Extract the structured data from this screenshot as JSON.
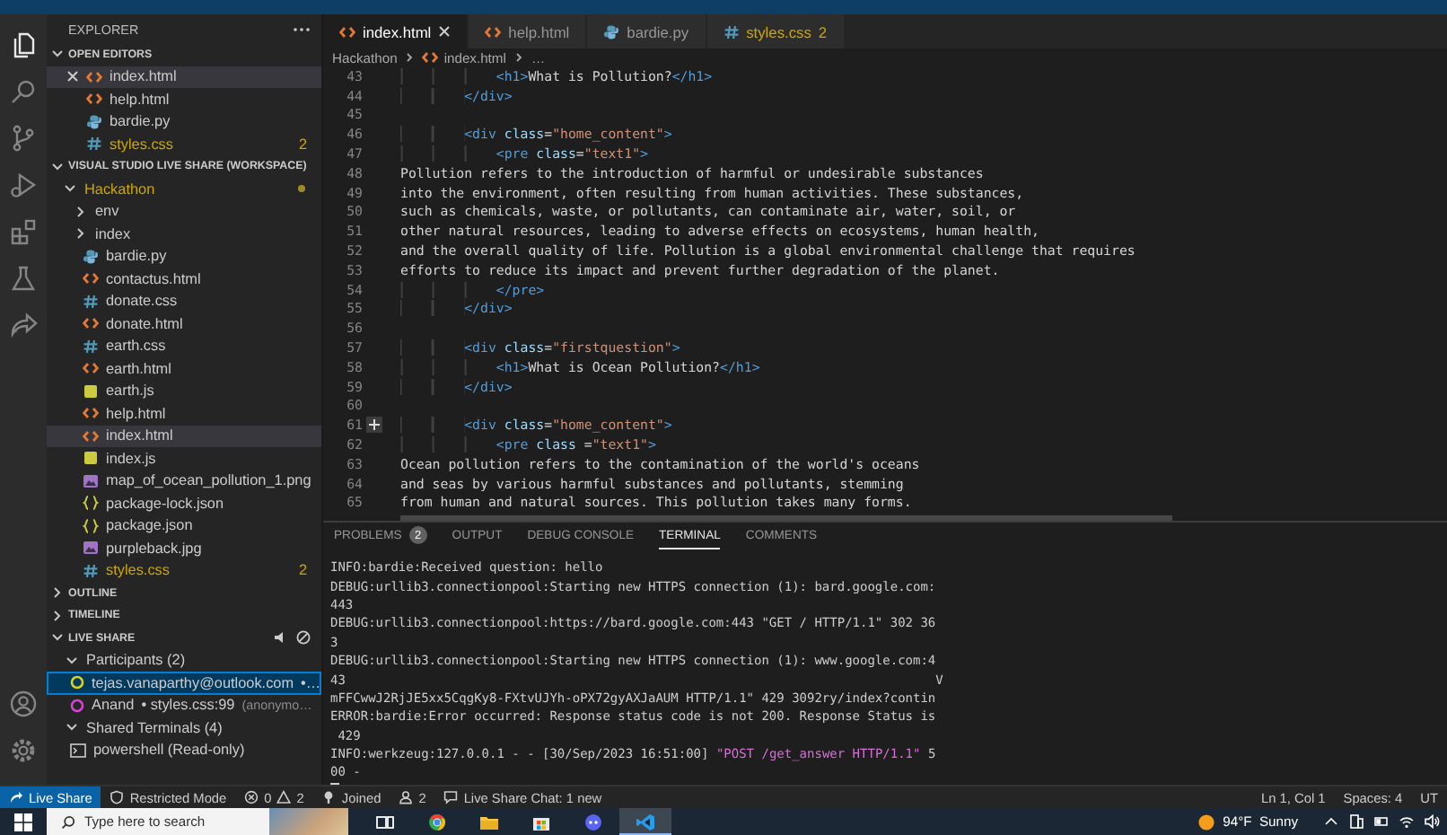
{
  "sidebar": {
    "title": "EXPLORER",
    "open_editors": {
      "heading": "OPEN EDITORS",
      "expanded": true,
      "items": [
        {
          "name": "index.html",
          "kind": "html",
          "selected": true
        },
        {
          "name": "help.html",
          "kind": "html",
          "selected": false
        },
        {
          "name": "bardie.py",
          "kind": "python",
          "selected": false
        },
        {
          "name": "styles.css",
          "kind": "css",
          "selected": false,
          "badge": "2"
        }
      ]
    },
    "workspace": {
      "heading": "VISUAL STUDIO LIVE SHARE (WORKSPACE)",
      "expanded": true,
      "tree": [
        {
          "name": "Hackathon",
          "kind": "folder",
          "expanded": true,
          "modified": true,
          "selected": false,
          "children": [
            {
              "name": "env",
              "kind": "folder",
              "expanded": false,
              "modified": false,
              "selected": false
            },
            {
              "name": "index",
              "kind": "folder",
              "expanded": false,
              "modified": false,
              "selected": false
            },
            {
              "name": "bardie.py",
              "kind": "python",
              "selected": false
            },
            {
              "name": "contactus.html",
              "kind": "html",
              "selected": false
            },
            {
              "name": "donate.css",
              "kind": "css",
              "selected": false
            },
            {
              "name": "donate.html",
              "kind": "html",
              "selected": false
            },
            {
              "name": "earth.css",
              "kind": "css",
              "selected": false
            },
            {
              "name": "earth.html",
              "kind": "html",
              "selected": false
            },
            {
              "name": "earth.js",
              "kind": "js",
              "selected": false
            },
            {
              "name": "help.html",
              "kind": "html",
              "selected": false
            },
            {
              "name": "index.html",
              "kind": "html",
              "selected": true
            },
            {
              "name": "index.js",
              "kind": "js",
              "selected": false
            },
            {
              "name": "map_of_ocean_pollution_1.png",
              "kind": "image",
              "selected": false
            },
            {
              "name": "package-lock.json",
              "kind": "json",
              "selected": false
            },
            {
              "name": "package.json",
              "kind": "json",
              "selected": false
            },
            {
              "name": "purpleback.jpg",
              "kind": "image",
              "selected": false
            },
            {
              "name": "styles.css",
              "kind": "css",
              "selected": false,
              "badge": "2"
            }
          ]
        }
      ]
    },
    "outline": {
      "heading": "OUTLINE",
      "expanded": false
    },
    "timeline": {
      "heading": "TIMELINE",
      "expanded": false
    },
    "live_share": {
      "heading": "LIVE SHARE",
      "expanded": true,
      "groups": [
        {
          "label": "Participants (2)",
          "kind": "participants",
          "expanded": true,
          "children": [
            {
              "name": "tejas.vanaparthy@outlook.com",
              "detail": "•…",
              "selected": true,
              "color": "#d4d41e"
            },
            {
              "name": "Anand",
              "detail": "• styles.css:99",
              "note": "(anonymo…",
              "selected": false,
              "color": "#d643d6"
            }
          ]
        },
        {
          "label": "Shared Terminals (4)",
          "kind": "terminals",
          "expanded": true,
          "children": [
            {
              "name": "powershell (Read-only)",
              "selected": false
            }
          ]
        }
      ]
    }
  },
  "editor": {
    "tabs": [
      {
        "label": "index.html",
        "kind": "html",
        "selected": true
      },
      {
        "label": "help.html",
        "kind": "html",
        "selected": false
      },
      {
        "label": "bardie.py",
        "kind": "python",
        "selected": false
      },
      {
        "label": "styles.css",
        "kind": "css",
        "selected": false,
        "badge": "2"
      }
    ],
    "breadcrumb": [
      {
        "label": "Hackathon"
      },
      {
        "label": "index.html",
        "kind": "html"
      },
      {
        "label": "…"
      }
    ],
    "lines": [
      {
        "number": "43",
        "comment": false,
        "code": "            <h1>What is Pollution?</h1>"
      },
      {
        "number": "44",
        "comment": false,
        "code": "        </div>"
      },
      {
        "number": "45",
        "comment": false
      },
      {
        "number": "46",
        "comment": false,
        "code": "        <div class=\"home_content\">"
      },
      {
        "number": "47",
        "comment": false,
        "code": "            <pre class=\"text1\">"
      },
      {
        "number": "48",
        "comment": false,
        "code": "Pollution refers to the introduction of harmful or undesirable substances"
      },
      {
        "number": "49",
        "comment": false,
        "code": "into the environment, often resulting from human activities. These substances,"
      },
      {
        "number": "50",
        "comment": false,
        "code": "such as chemicals, waste, or pollutants, can contaminate air, water, soil, or"
      },
      {
        "number": "51",
        "comment": false,
        "code": "other natural resources, leading to adverse effects on ecosystems, human health,"
      },
      {
        "number": "52",
        "comment": false,
        "code": "and the overall quality of life. Pollution is a global environmental challenge that requires"
      },
      {
        "number": "53",
        "comment": false,
        "code": "efforts to reduce its impact and prevent further degradation of the planet."
      },
      {
        "number": "54",
        "comment": false,
        "code": "            </pre>"
      },
      {
        "number": "55",
        "comment": false,
        "code": "        </div>"
      },
      {
        "number": "56",
        "comment": false
      },
      {
        "number": "57",
        "comment": false,
        "code": "        <div class=\"firstquestion\">"
      },
      {
        "number": "58",
        "comment": false,
        "code": "            <h1>What is Ocean Pollution?</h1>"
      },
      {
        "number": "59",
        "comment": false,
        "code": "        </div>"
      },
      {
        "number": "60",
        "comment": false
      },
      {
        "number": "61",
        "comment": true,
        "code": "        <div class=\"home_content\">"
      },
      {
        "number": "62",
        "comment": false,
        "code": "            <pre class =\"text1\">"
      },
      {
        "number": "63",
        "comment": false,
        "code": "Ocean pollution refers to the contamination of the world's oceans"
      },
      {
        "number": "64",
        "comment": false,
        "code": "and seas by various harmful substances and pollutants, stemming"
      },
      {
        "number": "65",
        "comment": false,
        "code": "from human and natural sources. This pollution takes many forms."
      }
    ]
  },
  "panel": {
    "tabs": [
      {
        "label": "PROBLEMS",
        "selected": false,
        "badge": "2"
      },
      {
        "label": "OUTPUT",
        "selected": false
      },
      {
        "label": "DEBUG CONSOLE",
        "selected": false
      },
      {
        "label": "TERMINAL",
        "selected": true
      },
      {
        "label": "COMMENTS",
        "selected": false
      }
    ],
    "terminal": {
      "cursor": true,
      "lines": [
        {
          "parts": [
            {
              "kind": "plain",
              "text": "INFO:bardie:Received question: hello"
            }
          ]
        },
        {
          "parts": [
            {
              "kind": "plain",
              "text": "DEBUG:urllib3.connectionpool:Starting new HTTPS connection (1): bard.google.com:"
            }
          ]
        },
        {
          "parts": [
            {
              "kind": "plain",
              "text": "443"
            }
          ]
        },
        {
          "parts": [
            {
              "kind": "plain",
              "text": "DEBUG:urllib3.connectionpool:https://bard.google.com:443 \"GET / HTTP/1.1\" 302 36"
            }
          ]
        },
        {
          "parts": [
            {
              "kind": "plain",
              "text": "3"
            }
          ]
        },
        {
          "parts": [
            {
              "kind": "plain",
              "text": "DEBUG:urllib3.connectionpool:Starting new HTTPS connection (1): www.google.com:4"
            }
          ]
        },
        {
          "parts": [
            {
              "kind": "plain",
              "text": "43"
            },
            {
              "kind": "end",
              "text": "V"
            }
          ]
        },
        {
          "parts": [
            {
              "kind": "plain",
              "text": "mFFCwwJ2RjJE5xx5CqgKy8-FXtvUJYh-oPX72gyAXJaAUM HTTP/1.1\" 429 3092ry/index?contin"
            }
          ]
        },
        {
          "parts": [
            {
              "kind": "plain",
              "text": "ERROR:bardie:Error occurred: Response status code is not 200. Response Status is"
            }
          ]
        },
        {
          "parts": [
            {
              "kind": "plain",
              "text": " 429"
            }
          ]
        },
        {
          "parts": [
            {
              "kind": "plain",
              "text": "INFO:werkzeug:127.0.0.1 - - [30/Sep/2023 16:51:00] "
            },
            {
              "kind": "string",
              "text": "\"POST /get_answer HTTP/1.1\""
            },
            {
              "kind": "plain",
              "text": " 5"
            }
          ]
        },
        {
          "parts": [
            {
              "kind": "plain",
              "text": "00 -"
            }
          ]
        }
      ]
    }
  },
  "status_bar": {
    "left": [
      {
        "kind": "remote",
        "label": "Live Share"
      },
      {
        "kind": "restricted",
        "label": "Restricted Mode"
      },
      {
        "kind": "problems",
        "errors": "0",
        "warnings": "2"
      },
      {
        "kind": "joined",
        "label": "Joined"
      },
      {
        "kind": "participants",
        "label": "2"
      },
      {
        "kind": "chat",
        "label": "Live Share Chat: 1 new"
      }
    ],
    "right": [
      "Ln 1, Col 1",
      "Spaces: 4",
      "UT"
    ]
  },
  "taskbar": {
    "search_placeholder": "Type here to search",
    "apps": [
      {
        "kind": "task_view",
        "selected": false
      },
      {
        "kind": "browser",
        "selected": false
      },
      {
        "kind": "files",
        "selected": false
      },
      {
        "kind": "store",
        "selected": false
      },
      {
        "kind": "chat",
        "selected": false
      },
      {
        "kind": "code",
        "selected": true
      }
    ],
    "weather": "94°F  Sunny"
  }
}
